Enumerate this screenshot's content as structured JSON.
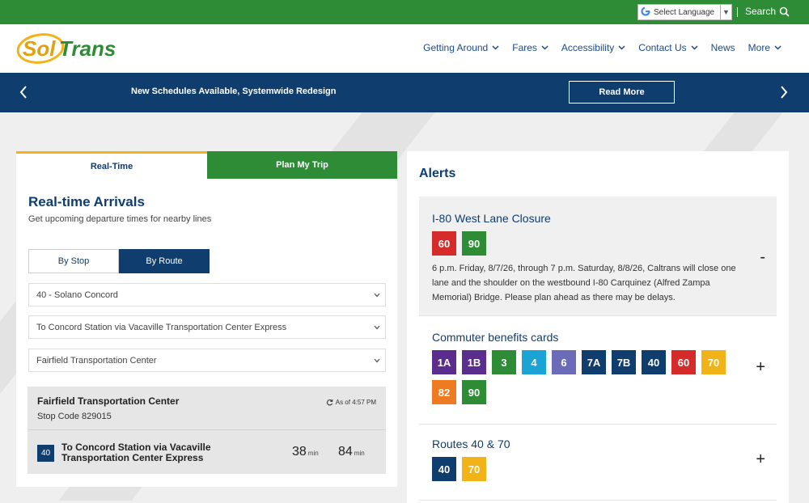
{
  "utility": {
    "language_label": "Select Language",
    "search_label": "Search"
  },
  "header": {
    "logo_text_sol": "Sol",
    "logo_text_trans": "Trans",
    "nav": [
      {
        "label": "Getting Around",
        "has_menu": true
      },
      {
        "label": "Fares",
        "has_menu": true
      },
      {
        "label": "Accessibility",
        "has_menu": true
      },
      {
        "label": "Contact Us",
        "has_menu": true
      },
      {
        "label": "News",
        "has_menu": false
      },
      {
        "label": "More",
        "has_menu": true
      }
    ]
  },
  "banner": {
    "text": "New Schedules Available, Systemwide Redesign",
    "button_label": "Read More"
  },
  "planner": {
    "tabs": {
      "realtime": "Real-Time",
      "plan": "Plan My Trip"
    },
    "title": "Real-time Arrivals",
    "subtitle": "Get upcoming departure times for nearby lines",
    "toggle": {
      "by_stop": "By Stop",
      "by_route": "By Route",
      "selected": "By Route"
    },
    "selects": {
      "route": "40 - Solano Concord",
      "direction": "To Concord Station via Vacaville Transportation Center Express",
      "stop": "Fairfield Transportation Center"
    },
    "result": {
      "stop_name": "Fairfield Transportation Center",
      "stop_code": "Stop Code 829015",
      "as_of": "As of 4:57 PM",
      "route_number": "40",
      "destination": "To Concord Station via Vacaville Transportation Center Express",
      "etas": [
        {
          "value": "38",
          "unit": "min"
        },
        {
          "value": "84",
          "unit": "min"
        }
      ]
    }
  },
  "alerts": {
    "title": "Alerts",
    "items": [
      {
        "title": "I-80 West Lane Closure",
        "routes": [
          "60",
          "90"
        ],
        "description": "6 p.m. Friday, 8/7/26, through 7 p.m. Saturday, 8/8/26, Caltrans will close one lane and the shoulder on the westbound I-80 Carquinez (Alfred Zampa Memorial) Bridge. Please plan ahead as there may be delays.",
        "expanded": true,
        "toggle": "-"
      },
      {
        "title": "Commuter benefits cards",
        "routes": [
          "1A",
          "1B",
          "3",
          "4",
          "6",
          "7A",
          "7B",
          "40",
          "60",
          "70",
          "82",
          "90"
        ],
        "expanded": false,
        "toggle": "+"
      },
      {
        "title": "Routes 40 & 70",
        "routes": [
          "40",
          "70"
        ],
        "expanded": false,
        "toggle": "+"
      }
    ]
  },
  "route_colors": {
    "1A": "#5b2d8e",
    "1B": "#5b2d8e",
    "3": "#2e8b36",
    "4": "#1ba3d6",
    "6": "#6b6bb8",
    "7A": "#0f3d6e",
    "7B": "#0f3d6e",
    "40": "#0f3d6e",
    "60": "#d62b2b",
    "70": "#f2b318",
    "82": "#ee7b22",
    "90": "#2e8b36"
  },
  "colors": {
    "brand_green": "#2e8b36",
    "brand_navy": "#0f3d6e",
    "accent_gold": "#f2b318"
  }
}
